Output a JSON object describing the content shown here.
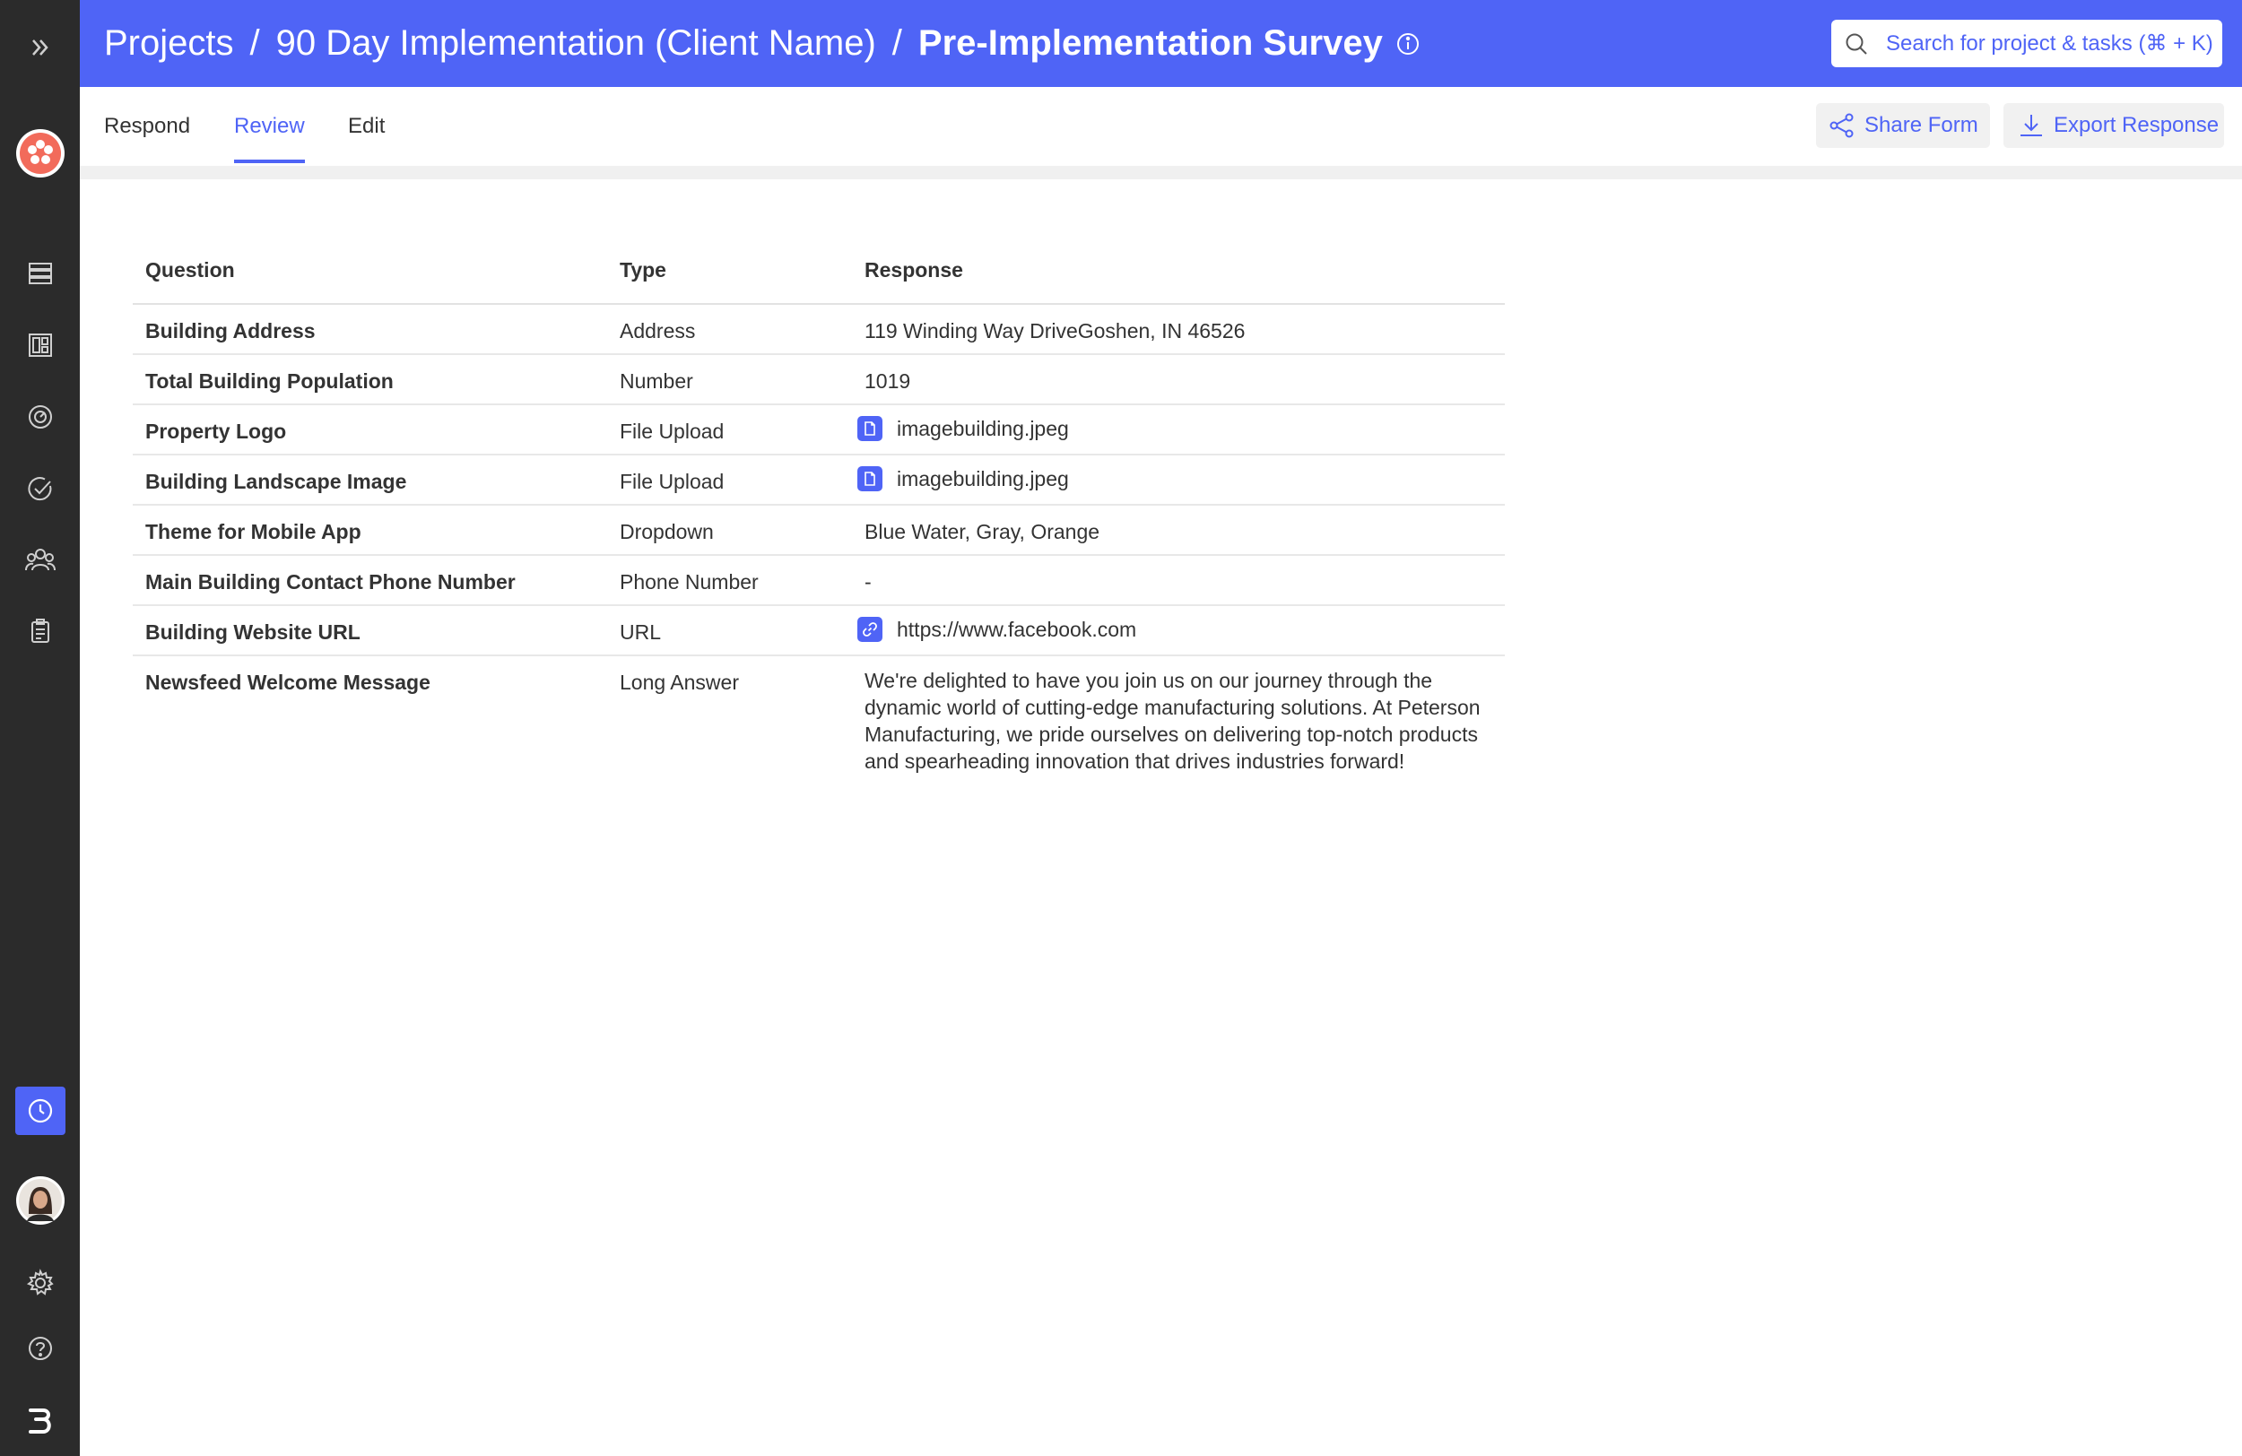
{
  "breadcrumb": {
    "projects": "Projects",
    "separator": "/",
    "project": "90 Day Implementation (Client Name)",
    "current": "Pre-Implementation Survey"
  },
  "search": {
    "placeholder": "Search for project & tasks (⌘ + K)"
  },
  "tabs": [
    {
      "label": "Respond"
    },
    {
      "label": "Review",
      "active": true
    },
    {
      "label": "Edit"
    }
  ],
  "actions": {
    "share_label": "Share Form",
    "export_label": "Export Response"
  },
  "table": {
    "headers": {
      "question": "Question",
      "type": "Type",
      "response": "Response"
    },
    "rows": [
      {
        "question": "Building Address",
        "type": "Address",
        "response": "119 Winding Way DriveGoshen, IN 46526"
      },
      {
        "question": "Total Building Population",
        "type": "Number",
        "response": "1019"
      },
      {
        "question": "Property Logo",
        "type": "File Upload",
        "response": "imagebuilding.jpeg",
        "icon": "file-icon"
      },
      {
        "question": "Building Landscape Image",
        "type": "File Upload",
        "response": "imagebuilding.jpeg",
        "icon": "file-icon"
      },
      {
        "question": "Theme for Mobile App",
        "type": "Dropdown",
        "response": "Blue Water, Gray, Orange"
      },
      {
        "question": "Main Building Contact Phone Number",
        "type": "Phone Number",
        "response": "-"
      },
      {
        "question": "Building Website URL",
        "type": "URL",
        "response": "https://www.facebook.com",
        "icon": "link-icon"
      },
      {
        "question": "Newsfeed Welcome Message",
        "type": "Long Answer",
        "response": "We're delighted to have you join us on our journey through the dynamic world of cutting-edge manufacturing solutions. At Peterson Manufacturing, we pride ourselves on delivering top-notch products and spearheading innovation that drives industries forward!"
      }
    ]
  },
  "sidebar": {
    "icons": [
      "expand-icon",
      "logo-icon",
      "list-icon",
      "dashboard-icon",
      "gauge-icon",
      "check-circle-icon",
      "people-icon",
      "clipboard-icon",
      "clock-icon",
      "avatar",
      "gear-icon",
      "help-icon",
      "brand-icon"
    ]
  },
  "colors": {
    "accent": "#4f64f6",
    "sidebar": "#2b2b2b",
    "logo": "#f26b5b"
  }
}
